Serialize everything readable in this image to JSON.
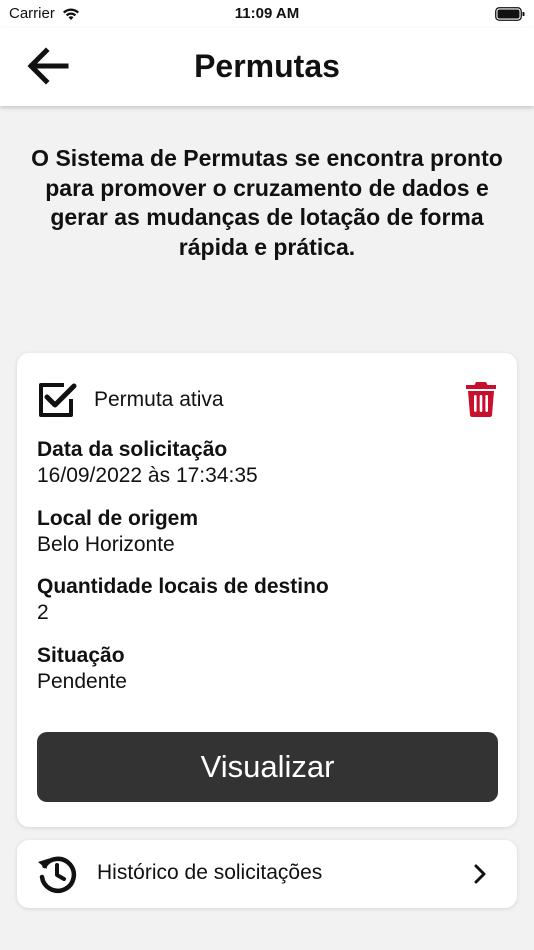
{
  "status_bar": {
    "carrier": "Carrier",
    "time": "11:09 AM"
  },
  "nav": {
    "title": "Permutas",
    "back_icon": "arrow-left-icon"
  },
  "intro_text": "O Sistema de Permutas se encontra pronto para promover o cruzamento de dados e gerar as mudanças de lotação de forma rápida e prática.",
  "card": {
    "active_label": "Permuta ativa",
    "active_checked": true,
    "delete_icon": "trash-icon",
    "delete_color": "#c8102e",
    "fields": [
      {
        "label": "Data da solicitação",
        "value": "16/09/2022 às 17:34:35"
      },
      {
        "label": "Local de origem",
        "value": "Belo Horizonte"
      },
      {
        "label": "Quantidade locais de destino",
        "value": "2"
      },
      {
        "label": "Situação",
        "value": "Pendente"
      }
    ],
    "view_button": "Visualizar"
  },
  "history": {
    "label": "Histórico de solicitações",
    "icon": "history-icon"
  },
  "colors": {
    "background": "#f2f2f2",
    "button_dark": "#333333",
    "accent_red": "#c8102e"
  }
}
